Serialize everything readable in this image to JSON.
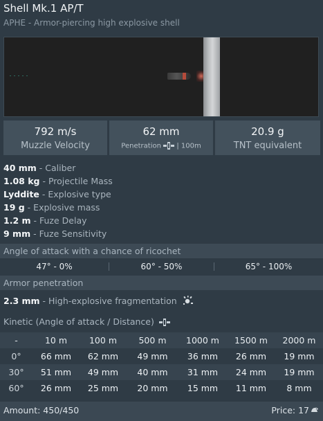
{
  "header": {
    "title": "Shell Mk.1 AP/T",
    "subtitle": "APHE - Armor-piercing high explosive shell"
  },
  "stats": {
    "muzzle_velocity": {
      "value": "792 m/s",
      "label": "Muzzle Velocity"
    },
    "penetration": {
      "value": "62 mm",
      "label": "Penetration",
      "distance": "| 100m"
    },
    "tnt": {
      "value": "20.9 g",
      "label": "TNT equivalent"
    }
  },
  "properties": [
    {
      "value": "40 mm",
      "name": "Caliber"
    },
    {
      "value": "1.08 kg",
      "name": "Projectile Mass"
    },
    {
      "value": "Lyddite",
      "name": "Explosive type"
    },
    {
      "value": "19 g",
      "name": "Explosive mass"
    },
    {
      "value": "1.2 m",
      "name": "Fuze Delay"
    },
    {
      "value": "9 mm",
      "name": "Fuze Sensitivity"
    }
  ],
  "ricochet": {
    "title": "Angle of attack with a chance of ricochet",
    "cells": [
      "47° - 0%",
      "60° - 50%",
      "65° - 100%"
    ]
  },
  "armor_penetration": {
    "title": "Armor penetration",
    "he_value": "2.3 mm",
    "he_name": "High-explosive fragmentation",
    "kinetic_title": "Kinetic (Angle of attack / Distance)"
  },
  "pen_table": {
    "corner": "-",
    "headers": [
      "10 m",
      "100 m",
      "500 m",
      "1000 m",
      "1500 m",
      "2000 m"
    ],
    "rows": [
      {
        "angle": "0°",
        "values": [
          "66 mm",
          "62 mm",
          "49 mm",
          "36 mm",
          "26 mm",
          "19 mm"
        ]
      },
      {
        "angle": "30°",
        "values": [
          "51 mm",
          "49 mm",
          "40 mm",
          "31 mm",
          "24 mm",
          "19 mm"
        ]
      },
      {
        "angle": "60°",
        "values": [
          "26 mm",
          "25 mm",
          "20 mm",
          "15 mm",
          "11 mm",
          "8 mm"
        ]
      }
    ]
  },
  "footer": {
    "amount": "Amount: 450/450",
    "price": "Price: 17"
  },
  "colors": {
    "background": "#2f3b45",
    "section_header": "#3d4a55",
    "stat_box": "#43515c",
    "shell_band": "#b44b3b"
  },
  "icons": {
    "penetration": "penetration-icon",
    "fragmentation": "fragmentation-icon",
    "currency": "silver-lions-icon"
  }
}
